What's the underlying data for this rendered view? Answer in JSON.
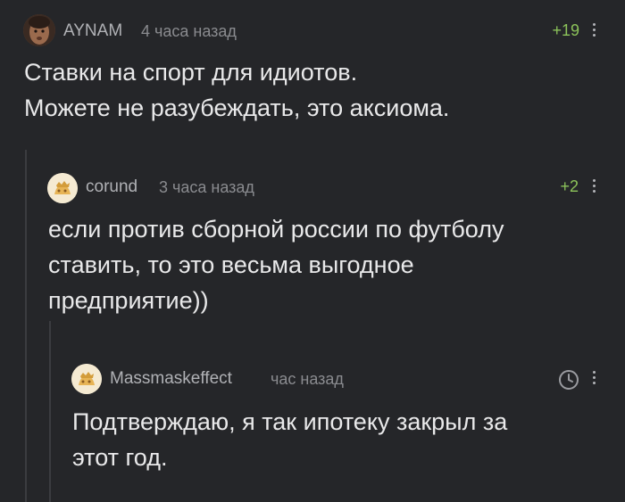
{
  "comments": [
    {
      "author": "AYNAM",
      "time": "4 часа назад",
      "rating": "+19",
      "lines": [
        "Ставки на спорт для идиотов.",
        "Можете не разубеждать, это аксиома."
      ]
    },
    {
      "author": "corund",
      "time": "3 часа назад",
      "rating": "+2",
      "lines": [
        "если против сборной россии по футболу",
        "ставить, то это весьма выгодное",
        "предприятие))"
      ]
    },
    {
      "author": "Massmaskeffect",
      "time": "час назад",
      "rating_icon": "clock-icon",
      "lines": [
        "Подтверждаю, я так ипотеку закрыл за",
        "этот год."
      ]
    }
  ],
  "icons": {
    "more": "more-vertical-icon",
    "avatar_default": "avatar-placeholder-icon"
  },
  "colors": {
    "background": "#252629",
    "rating_positive": "#8cc35a",
    "thread_line": "#3b3c40"
  }
}
